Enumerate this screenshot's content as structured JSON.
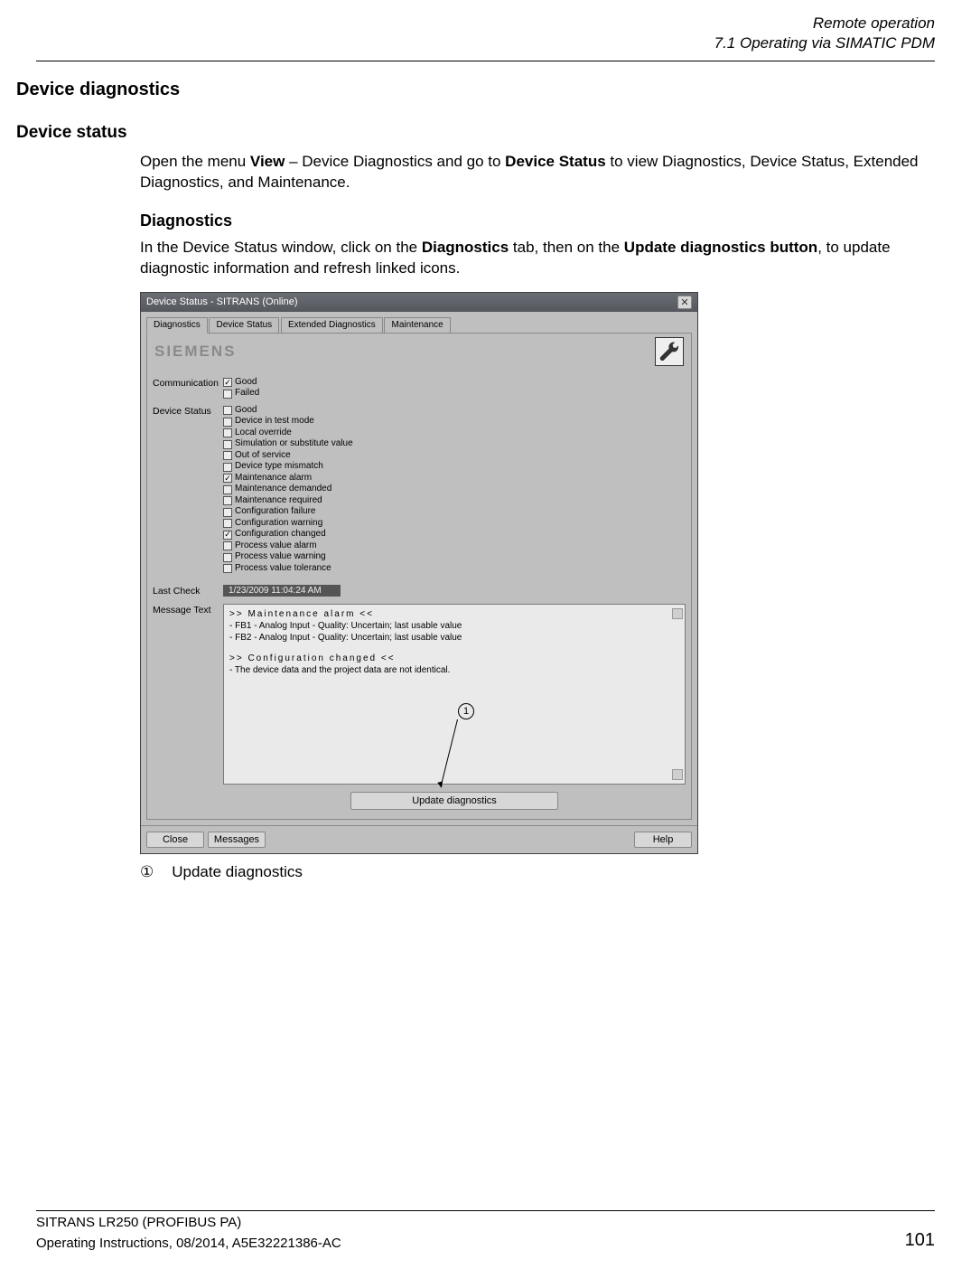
{
  "header": {
    "chapter": "Remote operation",
    "section": "7.1 Operating via SIMATIC PDM"
  },
  "h1": "Device diagnostics",
  "h2": "Device status",
  "p1_a": "Open the menu ",
  "p1_view": "View",
  "p1_b": " – Device Diagnostics and go to ",
  "p1_devstat": "Device Status",
  "p1_c": " to view Diagnostics, Device Status, Extended Diagnostics, and Maintenance.",
  "h3": "Diagnostics",
  "p2_a": "In the Device Status window, click on the ",
  "p2_diag": "Diagnostics",
  "p2_b": " tab, then on the ",
  "p2_upd": "Update diagnostics button",
  "p2_c": ", to update diagnostic information and refresh linked icons.",
  "legend": {
    "num": "①",
    "text": "Update diagnostics"
  },
  "footer": {
    "product": "SITRANS LR250 (PROFIBUS PA)",
    "doc": "Operating Instructions, 08/2014, A5E32221386-AC",
    "page": "101"
  },
  "dialog": {
    "title": "Device Status - SITRANS  (Online)",
    "tabs": [
      "Diagnostics",
      "Device Status",
      "Extended Diagnostics",
      "Maintenance"
    ],
    "brand": "SIEMENS",
    "labels": {
      "communication": "Communication",
      "device_status": "Device Status",
      "last_check": "Last Check",
      "message_text": "Message Text"
    },
    "communication": [
      {
        "label": "Good",
        "checked": true
      },
      {
        "label": "Failed",
        "checked": false
      }
    ],
    "device_status": [
      {
        "label": "Good",
        "checked": false
      },
      {
        "label": "Device in test mode",
        "checked": false
      },
      {
        "label": "Local override",
        "checked": false
      },
      {
        "label": "Simulation or substitute value",
        "checked": false
      },
      {
        "label": "Out of service",
        "checked": false
      },
      {
        "label": "Device type mismatch",
        "checked": false
      },
      {
        "label": "Maintenance alarm",
        "checked": true
      },
      {
        "label": "Maintenance demanded",
        "checked": false
      },
      {
        "label": "Maintenance required",
        "checked": false
      },
      {
        "label": "Configuration failure",
        "checked": false
      },
      {
        "label": "Configuration warning",
        "checked": false
      },
      {
        "label": "Configuration changed",
        "checked": true
      },
      {
        "label": "Process value alarm",
        "checked": false
      },
      {
        "label": "Process value warning",
        "checked": false
      },
      {
        "label": "Process value tolerance",
        "checked": false
      }
    ],
    "last_check": "1/23/2009 11:04:24 AM",
    "messages": {
      "h1": ">> Maintenance alarm <<",
      "l1": "- FB1 - Analog Input - Quality: Uncertain; last usable value",
      "l2": "- FB2 - Analog Input - Quality: Uncertain; last usable value",
      "h2": ">> Configuration changed <<",
      "l3": "- The device data and the project data are not identical."
    },
    "buttons": {
      "update": "Update diagnostics",
      "close": "Close",
      "messages": "Messages",
      "help": "Help"
    },
    "callout_num": "1"
  }
}
